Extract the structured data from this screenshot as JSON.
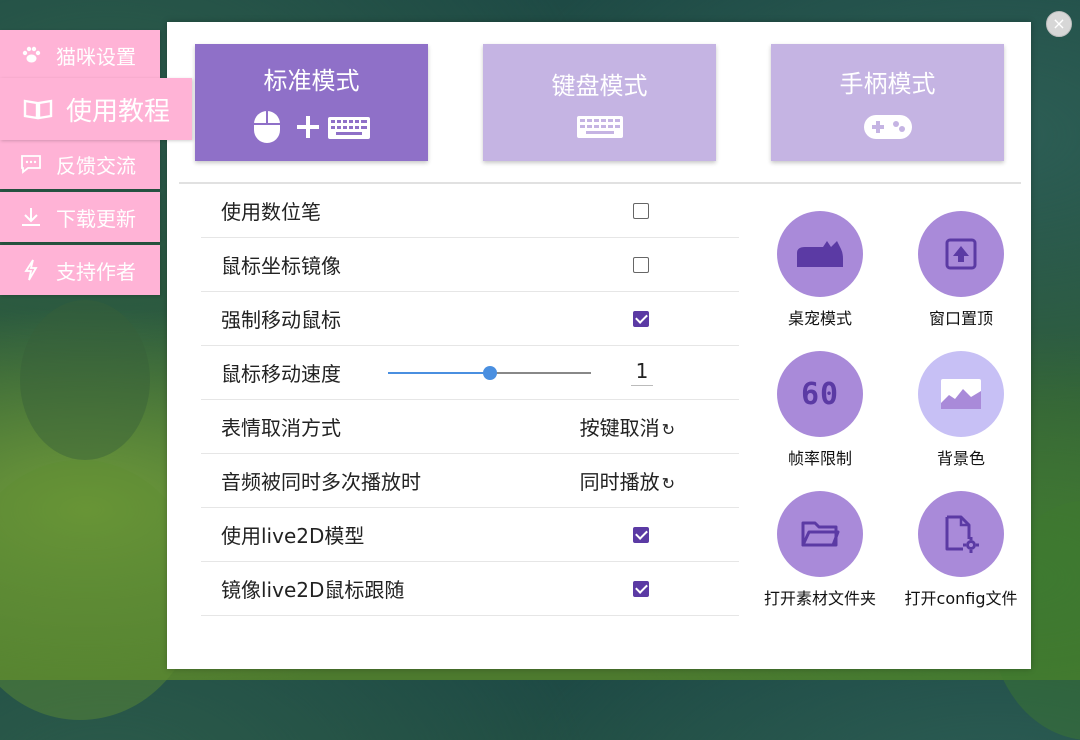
{
  "sidebar": {
    "items": [
      {
        "label": "猫咪设置",
        "icon": "paw-icon"
      },
      {
        "label": "使用教程",
        "icon": "book-icon"
      },
      {
        "label": "反馈交流",
        "icon": "chat-icon"
      },
      {
        "label": "下载更新",
        "icon": "download-icon"
      },
      {
        "label": "支持作者",
        "icon": "lightning-icon"
      }
    ],
    "active_index": 1,
    "color": "#ffb3d6"
  },
  "modes": [
    {
      "label": "标准模式",
      "state": "selected",
      "icon": "mouse-plus-keyboard-icon"
    },
    {
      "label": "键盘模式",
      "state": "unselected",
      "icon": "keyboard-icon"
    },
    {
      "label": "手柄模式",
      "state": "unselected",
      "icon": "gamepad-icon"
    }
  ],
  "settings": [
    {
      "label": "使用数位笔",
      "type": "checkbox",
      "checked": false
    },
    {
      "label": "鼠标坐标镜像",
      "type": "checkbox",
      "checked": false
    },
    {
      "label": "强制移动鼠标",
      "type": "checkbox",
      "checked": true
    },
    {
      "label": "鼠标移动速度",
      "type": "slider",
      "value": "1",
      "fraction": 0.5
    },
    {
      "label": "表情取消方式",
      "type": "cycle",
      "value": "按键取消"
    },
    {
      "label": "音频被同时多次播放时",
      "type": "cycle",
      "value": "同时播放"
    },
    {
      "label": "使用live2D模型",
      "type": "checkbox",
      "checked": true
    },
    {
      "label": "镜像live2D鼠标跟随",
      "type": "checkbox",
      "checked": true
    }
  ],
  "tools": [
    {
      "label": "桌宠模式",
      "icon": "cat-silhouette-icon"
    },
    {
      "label": "窗口置顶",
      "icon": "pin-top-icon"
    },
    {
      "label": "帧率限制",
      "icon": "fps-60-icon"
    },
    {
      "label": "背景色",
      "icon": "image-landscape-icon"
    },
    {
      "label": "打开素材文件夹",
      "icon": "folder-icon"
    },
    {
      "label": "打开config文件",
      "icon": "file-settings-icon"
    }
  ],
  "icons": {
    "fps_text": "60",
    "cycle_glyph": "↻",
    "close_glyph": "×"
  },
  "colors": {
    "accent": "#8f70c8",
    "accent_light": "#c5b4e3",
    "checkbox_checked": "#5b3aa4",
    "slider": "#4a8fe0"
  }
}
